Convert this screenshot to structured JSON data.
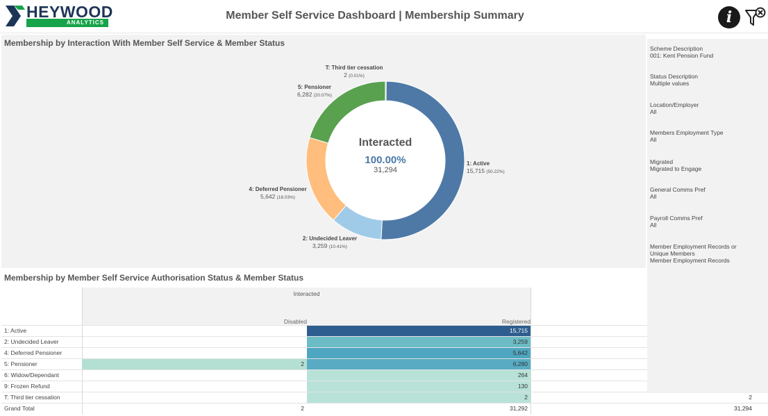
{
  "header": {
    "logo_word": "HEYWOOD",
    "logo_sub": "ANALYTICS",
    "title": "Member Self Service Dashboard | Membership Summary",
    "info_glyph": "i",
    "icons": [
      "info-icon",
      "filter-clear-icon"
    ]
  },
  "donut": {
    "title": "Membership by Interaction With Member Self Service & Member Status",
    "center_title": "Interacted",
    "center_percent": "100.00%",
    "center_count": "31,294",
    "colors": {
      "1: Active": "#4e79a7",
      "2: Undecided Leaver": "#a0cbe8",
      "4: Deferred Pensioner": "#ffbe7d",
      "5: Pensioner": "#59a14f",
      "T: Third tier cessation": "#8cd17d"
    }
  },
  "chart_data": {
    "type": "pie",
    "style": "donut",
    "categories": [
      "1: Active",
      "2: Undecided Leaver",
      "4: Deferred Pensioner",
      "5: Pensioner",
      "T: Third tier cessation"
    ],
    "values": [
      15715,
      3259,
      5642,
      6282,
      2
    ],
    "labels": {
      "values": [
        "15,715",
        "3,259",
        "5,642",
        "6,282",
        "2"
      ],
      "percents": [
        "(50.22%)",
        "(10.41%)",
        "(18.03%)",
        "(20.07%)",
        "(0.01%)"
      ]
    },
    "minor_slices_unlabeled": [
      130,
      264
    ]
  },
  "table": {
    "title": "Membership by Member Self Service Authorisation Status & Member Status",
    "header_group": "Interacted",
    "columns": [
      "Disabled",
      "Registered"
    ],
    "rows": [
      {
        "label": "1: Active",
        "disabled": "",
        "registered": "15,715",
        "extra": ""
      },
      {
        "label": "2: Undecided Leaver",
        "disabled": "",
        "registered": "3,259",
        "extra": ""
      },
      {
        "label": "4: Deferred Pensioner",
        "disabled": "",
        "registered": "5,642",
        "extra": ""
      },
      {
        "label": "5: Pensioner",
        "disabled": "2",
        "registered": "6,280",
        "extra": ""
      },
      {
        "label": "6: Widow/Dependant",
        "disabled": "",
        "registered": "264",
        "extra": ""
      },
      {
        "label": "9: Frozen Refund",
        "disabled": "",
        "registered": "130",
        "extra": ""
      },
      {
        "label": "T: Third tier cessation",
        "disabled": "",
        "registered": "2",
        "extra": "2"
      },
      {
        "label": "Grand Total",
        "disabled": "2",
        "registered": "31,292",
        "extra": "31,294"
      }
    ],
    "heat_colors": {
      "1: Active": "#2e5d8f",
      "2: Undecided Leaver": "#6cbcc6",
      "4: Deferred Pensioner": "#4fa6c0",
      "5: Pensioner": "#58abc2",
      "6: Widow/Dependant": "#b8e2d8",
      "9: Frozen Refund": "#b8e2d8",
      "T: Third tier cessation": "#b8e2d8",
      "disabled": "#b3e0d3"
    }
  },
  "filters": [
    {
      "label": "Scheme Description",
      "value": "001: Kent Pension Fund"
    },
    {
      "label": "Status Description",
      "value": "Multiple values"
    },
    {
      "label": "Location/Employer",
      "value": "All"
    },
    {
      "label": "Members Employment Type",
      "value": "All"
    },
    {
      "label": "Migrated",
      "value": "Migrated to Engage"
    },
    {
      "label": "General Comms Pref",
      "value": "All"
    },
    {
      "label": "Payroll Comms Pref",
      "value": "All"
    },
    {
      "label": "Member Employment Records or Unique Members",
      "value": "Member Employment Records"
    }
  ]
}
